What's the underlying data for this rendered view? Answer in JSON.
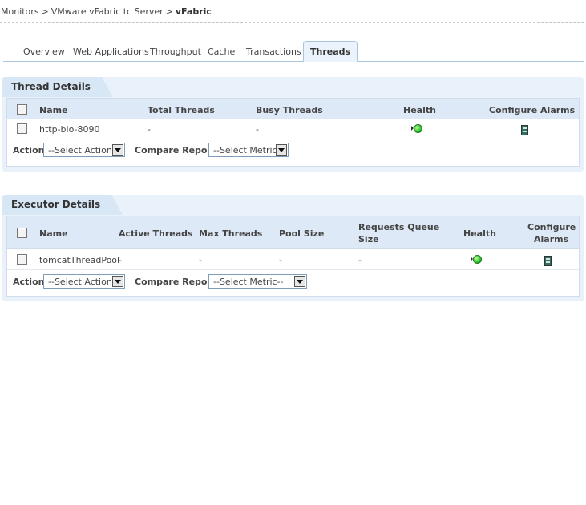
{
  "breadcrumb": {
    "items": [
      "Monitors",
      "VMware vFabric tc Server"
    ],
    "separator": ">",
    "current": "vFabric"
  },
  "tabs": [
    "Overview",
    "Web Applications",
    "Throughput",
    "Cache",
    "Transactions",
    "Threads"
  ],
  "active_tab": "Threads",
  "thread_details": {
    "title": "Thread Details",
    "columns": [
      "Name",
      "Total Threads",
      "Busy Threads",
      "Health",
      "Configure Alarms"
    ],
    "rows": [
      {
        "name": "http-bio-8090",
        "total_threads": "-",
        "busy_threads": "-",
        "health": "green-icon",
        "alarm": "alarm-icon"
      }
    ],
    "action_label": "Action",
    "action_select": "--Select Action--",
    "compare_label": "Compare Reports",
    "metric_select": "--Select Metric--"
  },
  "executor_details": {
    "title": "Executor Details",
    "columns": [
      "Name",
      "Active Threads",
      "Max Threads",
      "Pool Size",
      "Requests Queue",
      "Size",
      "Health",
      "Configure",
      "Alarms"
    ],
    "rows": [
      {
        "name": "tomcatThreadPool",
        "active_threads": "-",
        "max_threads": "-",
        "pool_size": "-",
        "queue_size": "-",
        "health": "green-icon",
        "alarm": "alarm-icon"
      }
    ],
    "action_label": "Action",
    "action_select": "--Select Action--",
    "compare_label": "Compare Reports",
    "metric_select": "--Select Metric--"
  }
}
